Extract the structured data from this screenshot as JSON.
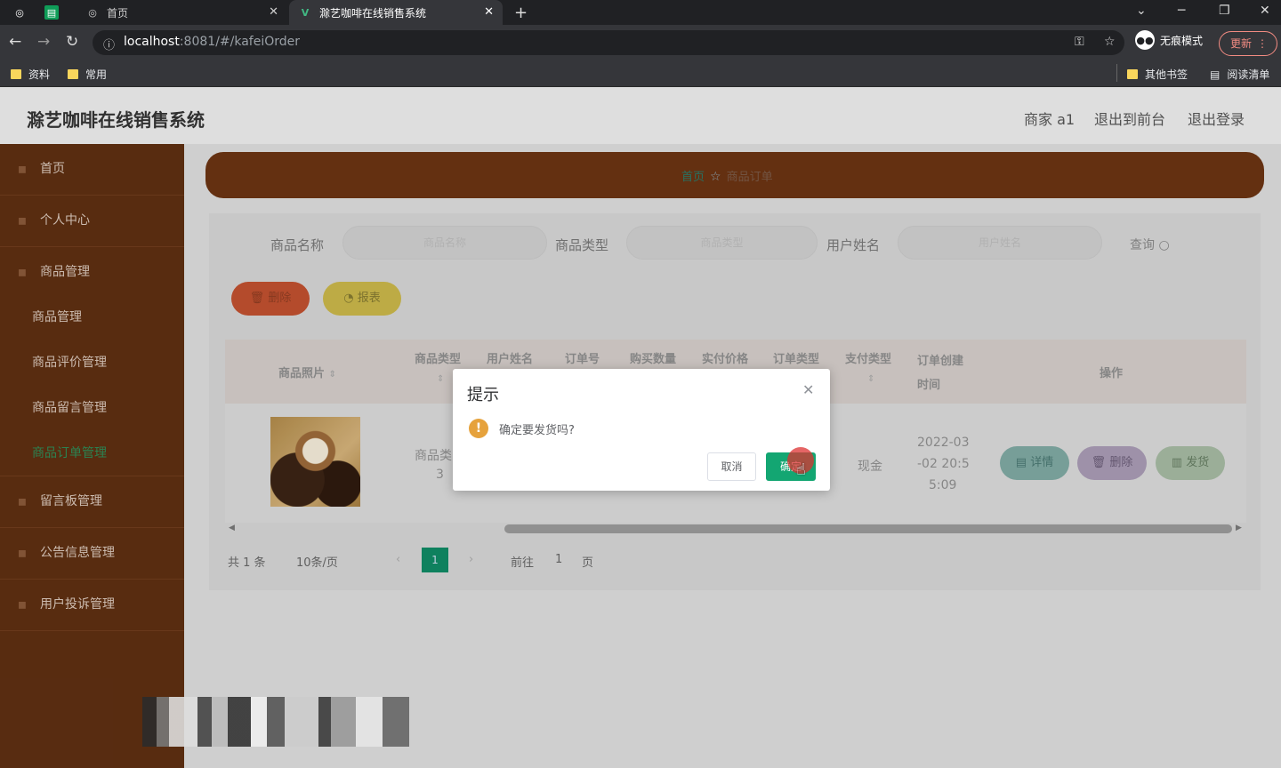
{
  "browser": {
    "tabs": [
      {
        "label": "首页",
        "active": false
      },
      {
        "label": "滁艺咖啡在线销售系统",
        "active": true
      }
    ],
    "new_tab": "+",
    "url_host": "localhost",
    "url_rest": ":8081/#/kafeiOrder",
    "incognito_label": "无痕模式",
    "update_label": "更新",
    "bookmarks": [
      "资料",
      "常用"
    ],
    "bookmarks_right": [
      "其他书签",
      "阅读清单"
    ]
  },
  "header": {
    "title": "滁艺咖啡在线销售系统",
    "links": [
      "商家 a1",
      "退出到前台",
      "退出登录"
    ]
  },
  "sidebar": {
    "items": [
      {
        "label": "首页",
        "type": "menu"
      },
      {
        "label": "个人中心",
        "type": "menu"
      },
      {
        "label": "商品管理",
        "type": "menu"
      },
      {
        "label": "商品管理",
        "type": "sub"
      },
      {
        "label": "商品评价管理",
        "type": "sub"
      },
      {
        "label": "商品留言管理",
        "type": "sub"
      },
      {
        "label": "商品订单管理",
        "type": "sub",
        "active": true
      },
      {
        "label": "留言板管理",
        "type": "menu"
      },
      {
        "label": "公告信息管理",
        "type": "menu"
      },
      {
        "label": "用户投诉管理",
        "type": "menu"
      }
    ]
  },
  "breadcrumb": {
    "home": "首页",
    "current": "商品订单"
  },
  "search": {
    "fields": [
      {
        "label": "商品名称",
        "placeholder": "商品名称"
      },
      {
        "label": "商品类型",
        "placeholder": "商品类型"
      },
      {
        "label": "用户姓名",
        "placeholder": "用户姓名"
      }
    ],
    "query_label": "查询"
  },
  "toolbar": {
    "delete_label": "删除",
    "report_label": "报表"
  },
  "table": {
    "headers": [
      "商品照片",
      "商品类型",
      "用户姓名",
      "订单号",
      "购买数量",
      "实付价格",
      "订单类型",
      "支付类型",
      "订单创建时间",
      "操作"
    ],
    "row": {
      "type_line1": "商品类",
      "type_line2": "3",
      "pay_type": "现金",
      "created_1": "2022-03",
      "created_2": "-02 20:5",
      "created_3": "5:09",
      "actions": [
        "详情",
        "删除",
        "发货"
      ]
    }
  },
  "pagination": {
    "total": "共 1 条",
    "page_size": "10条/页",
    "current_page": "1",
    "goto_label": "前往",
    "goto_value": "1",
    "page_suffix": "页"
  },
  "dialog": {
    "title": "提示",
    "message": "确定要发货吗?",
    "cancel_label": "取消",
    "confirm_label": "确定"
  },
  "colors": {
    "sidebar": "#5e2f12",
    "breadcrumb_bar": "#6b3413",
    "primary": "#13a672",
    "warning": "#e6a23c"
  }
}
